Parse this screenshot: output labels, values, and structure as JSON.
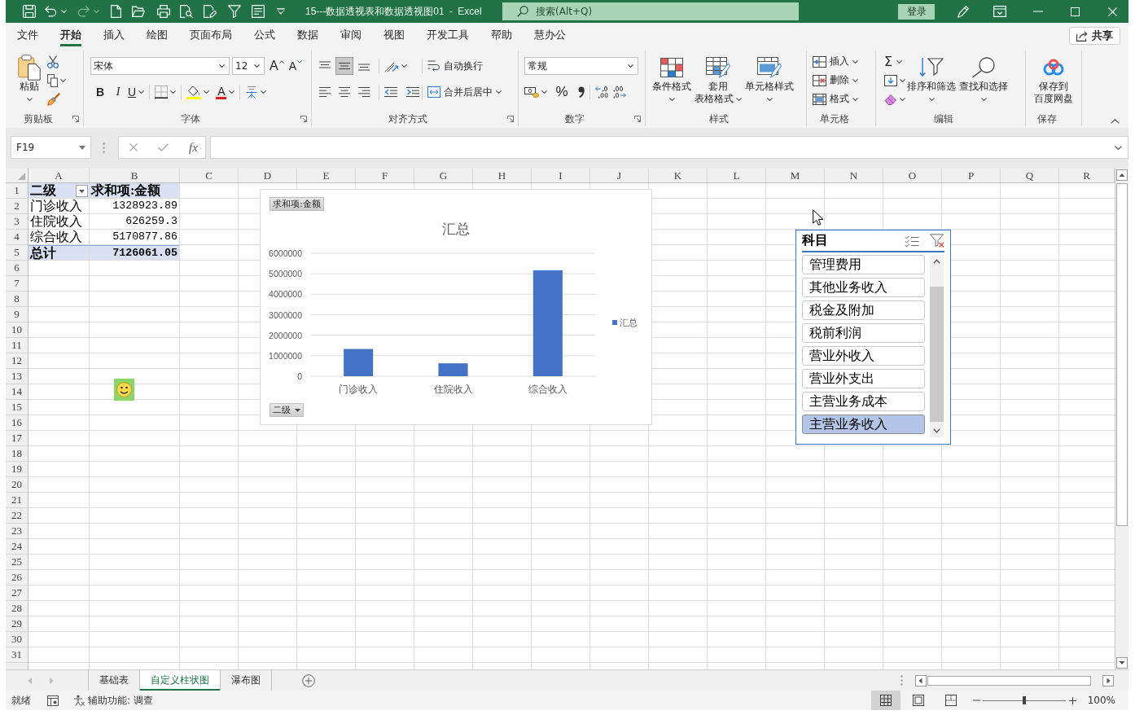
{
  "title_bar": {
    "title": "15---数据透视表和数据透视图01 - Excel",
    "search": {
      "placeholder": "搜索(Alt+Q)"
    },
    "sign_in": "登录"
  },
  "menu_tabs": [
    {
      "label": "文件",
      "selected": false
    },
    {
      "label": "开始",
      "selected": true
    },
    {
      "label": "插入",
      "selected": false
    },
    {
      "label": "绘图",
      "selected": false
    },
    {
      "label": "页面布局",
      "selected": false
    },
    {
      "label": "公式",
      "selected": false
    },
    {
      "label": "数据",
      "selected": false
    },
    {
      "label": "审阅",
      "selected": false
    },
    {
      "label": "视图",
      "selected": false
    },
    {
      "label": "开发工具",
      "selected": false
    },
    {
      "label": "帮助",
      "selected": false
    },
    {
      "label": "慧办公",
      "selected": false
    }
  ],
  "share": "共享",
  "ribbon": {
    "clipboard": {
      "label": "剪贴板",
      "paste": "粘贴"
    },
    "font": {
      "label": "字体",
      "font_name": "宋体",
      "font_size": "12",
      "grow": "A",
      "shrink": "A",
      "bold": "B",
      "italic": "I",
      "underline": "U",
      "font_color": "A"
    },
    "alignment": {
      "label": "对齐方式",
      "vertical_align": [
        {
          "kind": "top",
          "selected": false
        },
        {
          "kind": "middle",
          "selected": true
        },
        {
          "kind": "bottom",
          "selected": false
        }
      ],
      "wrap_text": "自动换行",
      "merge_center": "合并后居中"
    },
    "number": {
      "label": "数字",
      "format": "常规",
      "percent": "%"
    },
    "styles": {
      "label": "样式",
      "buttons": [
        {
          "kind": "conditional",
          "lines": [
            "条件格式"
          ]
        },
        {
          "kind": "table",
          "lines": [
            "套用",
            "表格格式"
          ]
        },
        {
          "kind": "cell",
          "lines": [
            "单元格样式"
          ]
        }
      ]
    },
    "cells": {
      "label": "单元格",
      "buttons": [
        {
          "kind": "insert",
          "label": "插入"
        },
        {
          "kind": "delete",
          "label": "删除"
        },
        {
          "kind": "format",
          "label": "格式"
        }
      ]
    },
    "editing": {
      "label": "编辑",
      "autosum": "Σ",
      "sort_filter": "排序和筛选",
      "find_select": "查找和选择"
    },
    "save": {
      "label": "保存",
      "lines": [
        "保存到",
        "百度网盘"
      ]
    }
  },
  "formula_bar": {
    "name_box": "F19",
    "function_label": "fx"
  },
  "sheet": {
    "columns": [
      "A",
      "B",
      "C",
      "D",
      "E",
      "F",
      "G",
      "H",
      "I",
      "J",
      "K",
      "L",
      "M",
      "N",
      "O",
      "P",
      "Q",
      "R"
    ],
    "rows": [
      "1",
      "2",
      "3",
      "4",
      "5",
      "6",
      "7",
      "8",
      "9",
      "10",
      "11",
      "12",
      "13",
      "14",
      "15",
      "16",
      "17",
      "18",
      "19",
      "20",
      "21",
      "22",
      "23",
      "24",
      "25",
      "26",
      "27",
      "28",
      "29",
      "30",
      "31"
    ],
    "pivot_table": {
      "row_header": "二级",
      "value_header": "求和项:金额",
      "rows": [
        {
          "label": "门诊收入",
          "value": "1328923.89"
        },
        {
          "label": "住院收入",
          "value": "626259.3"
        },
        {
          "label": "综合收入",
          "value": "5170877.86"
        }
      ],
      "total": {
        "label": "总计",
        "value": "7126061.05"
      }
    },
    "pivot_chart": {
      "field_button": "求和项:金额",
      "axis_field_button": "二级",
      "chart_data": {
        "type": "bar",
        "title": "汇总",
        "categories": [
          "门诊收入",
          "住院收入",
          "综合收入"
        ],
        "series": [
          {
            "name": "汇总",
            "color": "#4472c4",
            "values": [
              1330000,
              630000,
              5170000
            ]
          }
        ],
        "ylim": [
          0,
          6000000
        ],
        "yticks": [
          0,
          1000000,
          2000000,
          3000000,
          4000000,
          5000000,
          6000000
        ],
        "grid": true
      }
    },
    "slicer": {
      "title": "科目",
      "items": [
        {
          "label": "管理费用",
          "selected": false
        },
        {
          "label": "其他业务收入",
          "selected": false
        },
        {
          "label": "税金及附加",
          "selected": false
        },
        {
          "label": "税前利润",
          "selected": false
        },
        {
          "label": "营业外收入",
          "selected": false
        },
        {
          "label": "营业外支出",
          "selected": false
        },
        {
          "label": "主营业务成本",
          "selected": false
        },
        {
          "label": "主营业务收入",
          "selected": true
        }
      ]
    }
  },
  "sheet_tabs": [
    {
      "label": "基础表",
      "selected": false
    },
    {
      "label": "自定义柱状图",
      "selected": true
    },
    {
      "label": "瀑布图",
      "selected": false
    }
  ],
  "status_bar": {
    "ready": "就绪",
    "accessibility": "辅助功能: 调查",
    "views": [
      {
        "kind": "normal",
        "selected": true
      },
      {
        "kind": "page_layout",
        "selected": false
      },
      {
        "kind": "page_break",
        "selected": false
      }
    ],
    "zoom_slider": {
      "level": 0.5
    },
    "zoom": "100%"
  }
}
